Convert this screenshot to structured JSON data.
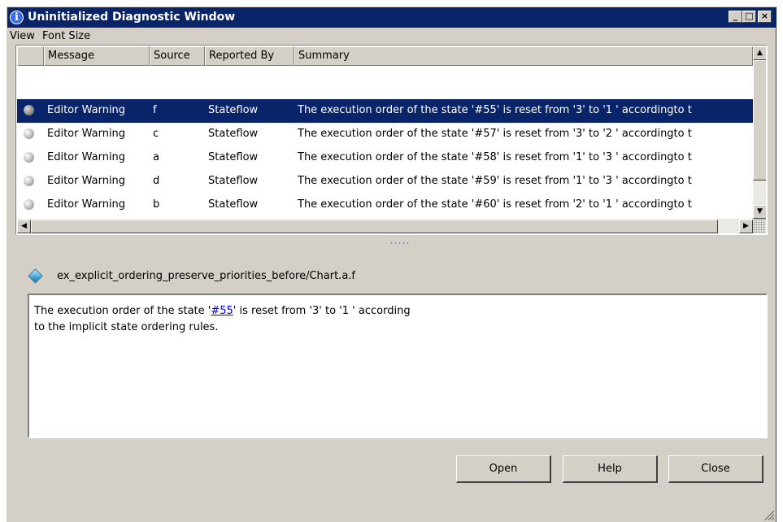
{
  "window": {
    "title": "Uninitialized Diagnostic Window",
    "icon_glyph": "i",
    "controls": {
      "minimize": "_",
      "maximize": "□",
      "close": "×"
    }
  },
  "menubar": {
    "items": [
      "View",
      "Font Size"
    ]
  },
  "table": {
    "headers": [
      "Message",
      "Source",
      "Reported By",
      "Summary"
    ],
    "rows": [
      {
        "message": "Editor Warning",
        "source": "f",
        "reported_by": "Stateflow",
        "summary": "The execution order of the state '#55' is reset from '3' to '1 ' accordingto t",
        "selected": true
      },
      {
        "message": "Editor Warning",
        "source": "c",
        "reported_by": "Stateflow",
        "summary": "The execution order of the state '#57' is reset from '3' to '2 ' accordingto t",
        "selected": false
      },
      {
        "message": "Editor Warning",
        "source": "a",
        "reported_by": "Stateflow",
        "summary": "The execution order of the state '#58' is reset from '1' to '3 ' accordingto t",
        "selected": false
      },
      {
        "message": "Editor Warning",
        "source": "d",
        "reported_by": "Stateflow",
        "summary": "The execution order of the state '#59' is reset from '1' to '3 ' accordingto t",
        "selected": false
      },
      {
        "message": "Editor Warning",
        "source": "b",
        "reported_by": "Stateflow",
        "summary": "The execution order of the state '#60' is reset from '2' to '1 ' accordingto t",
        "selected": false
      }
    ]
  },
  "detail": {
    "path": "ex_explicit_ordering_preserve_priorities_before/Chart.a.f",
    "text_before_link": "The execution order of the state '",
    "link": "#55",
    "text_after_link": "' is reset from '3' to '1 ' according",
    "line2": "to the implicit state ordering rules."
  },
  "buttons": {
    "open": "Open",
    "help": "Help",
    "close": "Close"
  },
  "icons": {
    "arrow_up": "▲",
    "arrow_down": "▼",
    "arrow_left": "◀",
    "arrow_right": "▶"
  },
  "colors": {
    "titlebar": "#0a246a",
    "selection": "#0a246a",
    "window_bg": "#d4d0c8",
    "link": "#0000ee"
  }
}
